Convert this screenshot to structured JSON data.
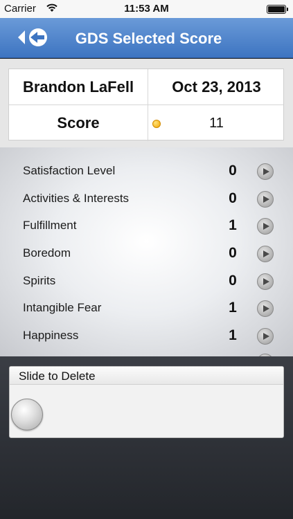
{
  "status_bar": {
    "carrier": "Carrier",
    "time": "11:53 AM",
    "battery_level": 1.0
  },
  "nav": {
    "title": "GDS Selected Score",
    "back_icon": "back-arrow-icon"
  },
  "header": {
    "patient_name": "Brandon LaFell",
    "date": "Oct 23, 2013",
    "score_label": "Score",
    "score_value": "11",
    "score_indicator_color": "#f2a400"
  },
  "questions": [
    {
      "label": "Satisfaction Level",
      "value": "0"
    },
    {
      "label": "Activities & Interests",
      "value": "0"
    },
    {
      "label": "Fulfillment",
      "value": "1"
    },
    {
      "label": "Boredom",
      "value": "0"
    },
    {
      "label": "Spirits",
      "value": "0"
    },
    {
      "label": "Intangible Fear",
      "value": "1"
    },
    {
      "label": "Happiness",
      "value": "1"
    }
  ],
  "slide_delete": {
    "label": "Slide to Delete"
  },
  "colors": {
    "nav_bar": "#4a80c9",
    "background": "#2a2d33"
  }
}
